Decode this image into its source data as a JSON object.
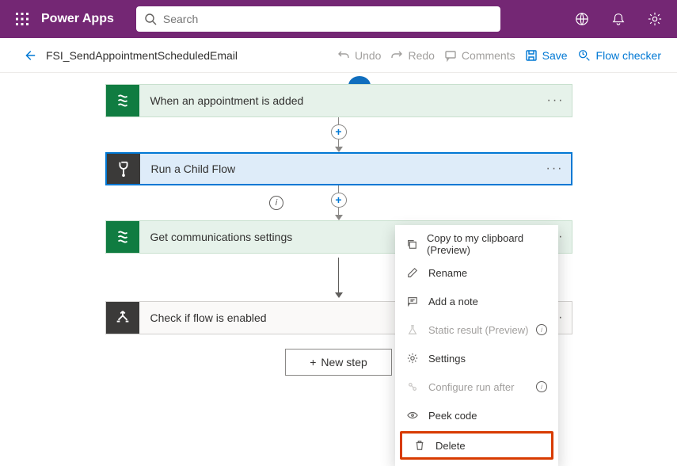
{
  "header": {
    "brand": "Power Apps",
    "search_placeholder": "Search"
  },
  "cmdbar": {
    "flow_name": "FSI_SendAppointmentScheduledEmail",
    "undo": "Undo",
    "redo": "Redo",
    "comments": "Comments",
    "save": "Save",
    "checker": "Flow checker"
  },
  "steps": [
    {
      "label": "When an appointment is added"
    },
    {
      "label": "Run a Child Flow"
    },
    {
      "label": "Get communications settings"
    },
    {
      "label": "Check if flow is enabled"
    }
  ],
  "new_step": "New step",
  "menu": {
    "copy": "Copy to my clipboard (Preview)",
    "rename": "Rename",
    "note": "Add a note",
    "static": "Static result (Preview)",
    "settings": "Settings",
    "run_after": "Configure run after",
    "peek": "Peek code",
    "delete": "Delete"
  }
}
